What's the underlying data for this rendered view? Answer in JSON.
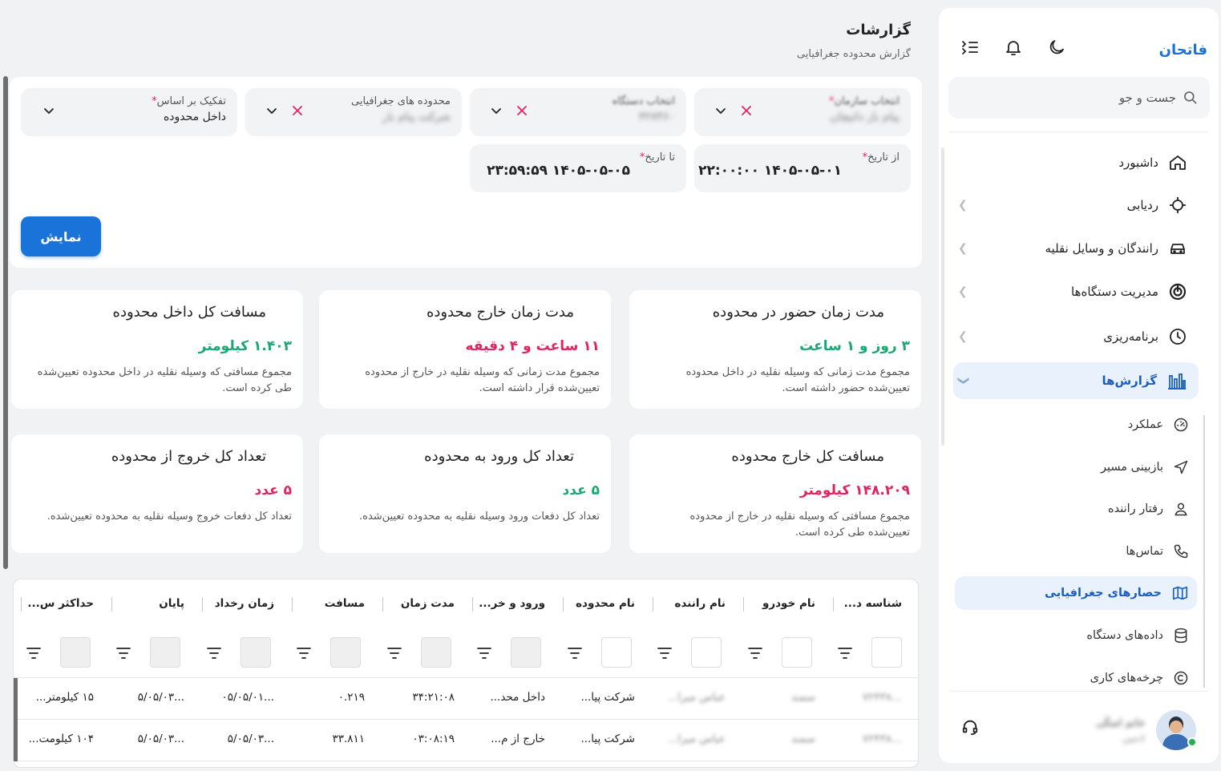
{
  "sidebar": {
    "brand": "فاتحان",
    "search_placeholder": "جست و جو",
    "top_icons": [
      "menu-icon",
      "bell-icon",
      "moon-icon"
    ],
    "nav": [
      {
        "label": "داشبورد",
        "icon": "home-icon"
      },
      {
        "label": "ردیابی",
        "icon": "crosshair-icon"
      },
      {
        "label": "رانندگان و وسایل نقلیه",
        "icon": "car-icon"
      },
      {
        "label": "مدیریت دستگاه‌ها",
        "icon": "device-icon"
      },
      {
        "label": "برنامه‌ریزی",
        "icon": "clock-icon"
      },
      {
        "label": "گزارش‌ها",
        "icon": "bar-chart-icon"
      }
    ],
    "sub_nav": [
      {
        "label": "عملکرد",
        "icon": "speedometer-icon"
      },
      {
        "label": "بازبینی مسیر",
        "icon": "navigation-icon"
      },
      {
        "label": "رفتار راننده",
        "icon": "user-icon"
      },
      {
        "label": "تماس‌ها",
        "icon": "phone-icon"
      },
      {
        "label": "حصارهای جغرافیایی",
        "icon": "map-icon"
      },
      {
        "label": "داده‌های دستگاه",
        "icon": "database-icon"
      },
      {
        "label": "چرخه‌های کاری",
        "icon": "copyright-icon"
      }
    ],
    "user": {
      "name": "خانم امنگی",
      "role": "ادمین"
    }
  },
  "header": {
    "title": "گزارشات",
    "breadcrumb": "گزارش محدوده جغرافیایی"
  },
  "filters": {
    "org": {
      "label": "انتخاب سازمان",
      "value": "پیام بار داتیچان"
    },
    "device": {
      "label": "انتخاب دستگاه",
      "value": "۳۲۷۳۶۰"
    },
    "zones": {
      "label": "محدوده های جغرافیایی",
      "value": "شرکت پیام بار"
    },
    "breakdown": {
      "label": "تفکیک بر اساس",
      "value": "داخل محدوده"
    },
    "from_date": {
      "label": "از تاریخ",
      "value": "۱۴۰۵-۰۵-۰۱ ۲۲:۰۰:۰۰"
    },
    "to_date": {
      "label": "تا تاریخ",
      "value": "۱۴۰۵-۰۵-۰۵ ۲۳:۵۹:۵۹"
    },
    "required_mark": "*",
    "show_button": "نمایش"
  },
  "cards": [
    {
      "title": "مدت زمان حضور در محدوده",
      "value": "۳ روز و ۱ ساعت",
      "desc": "مجموع مدت زمانی که وسیله نقلیه در داخل محدوده تعیین‌شده حضور داشته است.",
      "color": "#1aa772"
    },
    {
      "title": "مدت زمان خارج محدوده",
      "value": "۱۱ ساعت و ۴ دقیقه",
      "desc": "مجموع مدت زمانی که وسیله نقلیه در خارج از محدوده تعیین‌شده قرار داشته است.",
      "color": "#e0245e"
    },
    {
      "title": "مسافت کل داخل محدوده",
      "value": "۱.۴۰۳ کیلومتر",
      "desc": "مجموع مسافتی که وسیله نقلیه در داخل محدوده تعیین‌شده طی کرده است.",
      "color": "#1aa772"
    },
    {
      "title": "مسافت کل خارج محدوده",
      "value": "۱۴۸.۲۰۹ کیلومتر",
      "desc": "مجموع مسافتی که وسیله نقلیه در خارج از محدوده تعیین‌شده طی کرده است.",
      "color": "#e0245e"
    },
    {
      "title": "تعداد کل ورود به محدوده",
      "value": "۵ عدد",
      "desc": "تعداد کل دفعات ورود وسیله نقلیه به محدوده تعیین‌شده.",
      "color": "#1aa772"
    },
    {
      "title": "تعداد کل خروج از محدوده",
      "value": "۵ عدد",
      "desc": "تعداد کل دفعات خروج وسیله نقلیه به محدوده تعیین‌شده.",
      "color": "#e0245e"
    }
  ],
  "table": {
    "columns": [
      "شناسه د...",
      "نام خودرو",
      "نام راننده",
      "نام محدوده",
      "ورود و خر...",
      "مدت زمان",
      "مسافت",
      "زمان رخداد",
      "پایان",
      "حداکثر س..."
    ],
    "rows": [
      [
        "...۷۲۴۳۸",
        "سمند",
        "عباس میرا...",
        "شرکت پیا...",
        "داخل محد...",
        "۳۴:۲۱:۰۸",
        "۰.۲۱۹",
        "...۰۵/۰۵/۰۱",
        "...۵/۰۵/۰۳",
        "۱۵ کیلومتر..."
      ],
      [
        "...۷۲۴۳۸",
        "سمند",
        "عباس میرا...",
        "شرکت پیا...",
        "خارج از م...",
        "۰۳:۰۸:۱۹",
        "۳۳.۸۱۱",
        "...۵/۰۵/۰۳",
        "...۵/۰۵/۰۳",
        "۱۰۴ کیلومت..."
      ]
    ]
  }
}
